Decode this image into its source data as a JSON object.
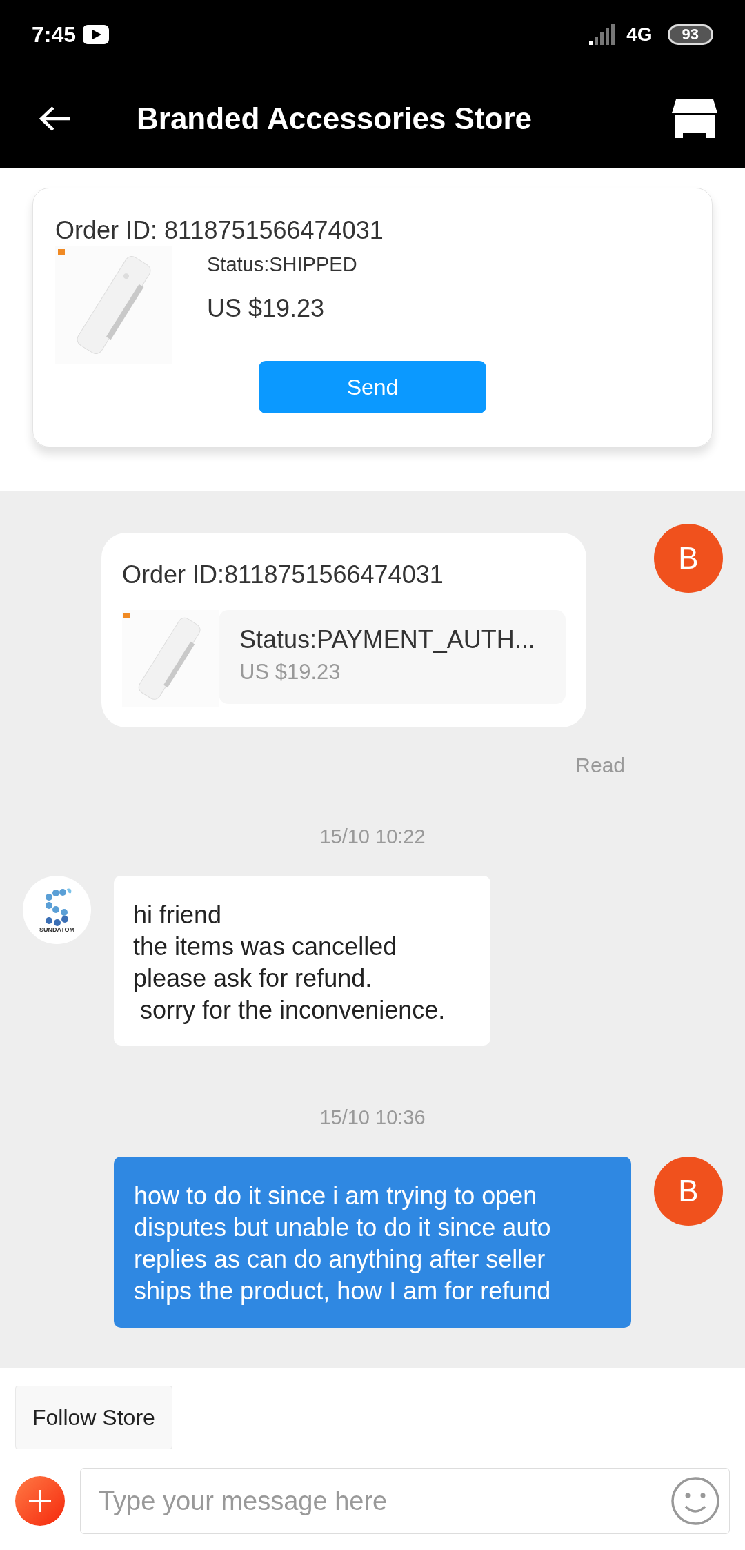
{
  "status_bar": {
    "time": "7:45",
    "network": "4G",
    "battery": "93"
  },
  "header": {
    "title": "Branded Accessories Store"
  },
  "order_card": {
    "order_id": "Order ID: 8118751566474031",
    "status": "Status:SHIPPED",
    "price": "US $19.23",
    "button": "Send"
  },
  "messages": [
    {
      "kind": "order_sent",
      "avatar": "B",
      "order_id": "Order ID:8118751566474031",
      "status": "Status:PAYMENT_AUTH...",
      "price": "US $19.23",
      "receipt": "Read"
    },
    {
      "kind": "time",
      "text": "15/10 10:22"
    },
    {
      "kind": "text_received",
      "avatar_label": "SUNDATOM",
      "lines": [
        "hi friend",
        "the items was cancelled",
        "please ask for refund.",
        " sorry for the inconvenience."
      ]
    },
    {
      "kind": "time",
      "text": "15/10 10:36"
    },
    {
      "kind": "text_sent",
      "avatar": "B",
      "lines": [
        "how to do it since i am trying to open",
        "disputes but unable to do it since auto",
        "replies as can do anything after seller",
        "ships the product, how I am for refund"
      ]
    }
  ],
  "follow_button": "Follow Store",
  "composer": {
    "placeholder": "Type your message here"
  }
}
